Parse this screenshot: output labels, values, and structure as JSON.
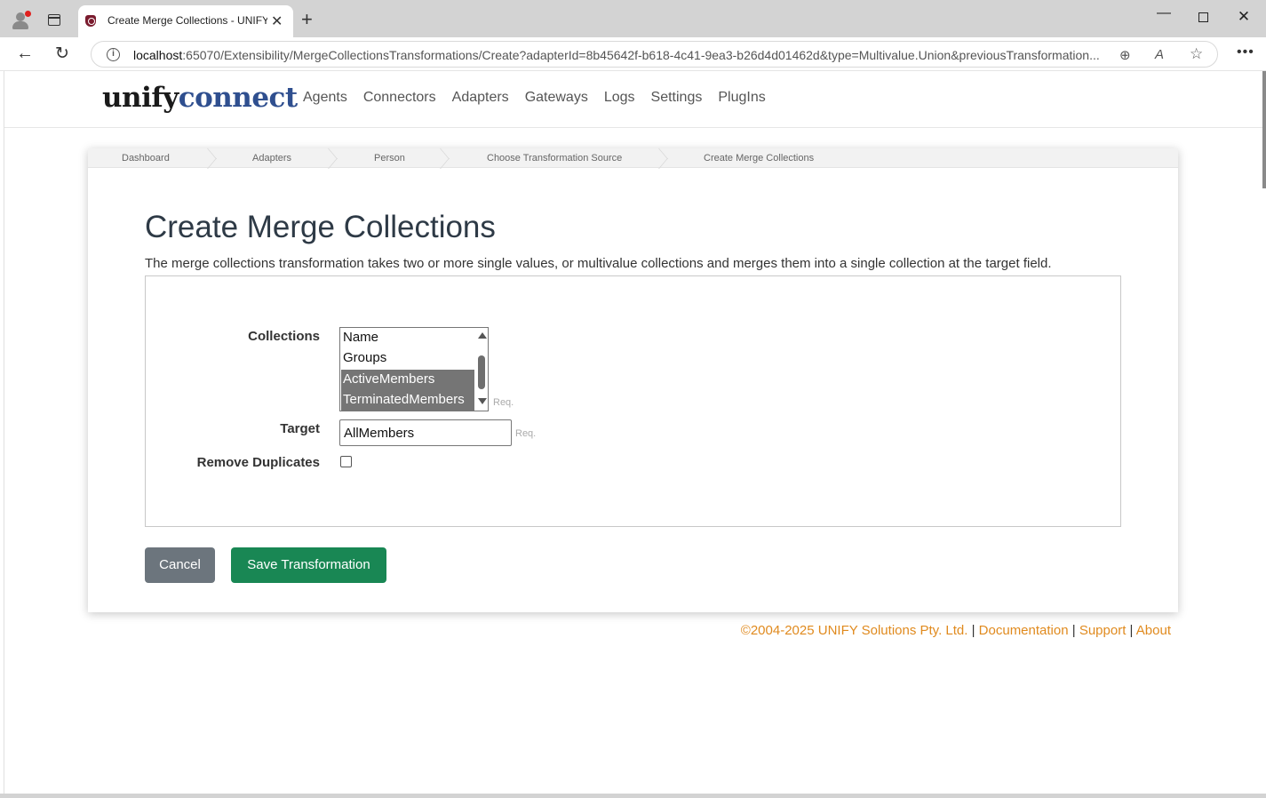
{
  "browser": {
    "tab_title": "Create Merge Collections - UNIFY",
    "url_host": "localhost",
    "url_rest": ":65070/Extensibility/MergeCollectionsTransformations/Create?adapterId=8b45642f-b618-4c41-9ea3-b26d4d01462d&type=Multivalue.Union&previousTransformation..."
  },
  "logo": {
    "part1": "unify",
    "part2": "connect"
  },
  "nav": [
    "Agents",
    "Connectors",
    "Adapters",
    "Gateways",
    "Logs",
    "Settings",
    "PlugIns"
  ],
  "breadcrumb": [
    "Dashboard",
    "Adapters",
    "Person",
    "Choose Transformation Source",
    "Create Merge Collections"
  ],
  "page": {
    "title": "Create Merge Collections",
    "description": "The merge collections transformation takes two or more single values, or multivalue collections and merges them into a single collection at the target field."
  },
  "form": {
    "collections_label": "Collections",
    "collections_options": [
      {
        "label": "Name",
        "selected": false
      },
      {
        "label": "Groups",
        "selected": false
      },
      {
        "label": "ActiveMembers",
        "selected": true
      },
      {
        "label": "TerminatedMembers",
        "selected": true
      }
    ],
    "required_hint": "Req.",
    "target_label": "Target",
    "target_value": "AllMembers",
    "remove_duplicates_label": "Remove Duplicates",
    "remove_duplicates_checked": false
  },
  "buttons": {
    "cancel": "Cancel",
    "save": "Save Transformation"
  },
  "footer": {
    "copyright": "©2004-2025 UNIFY Solutions Pty. Ltd.",
    "documentation": "Documentation",
    "support": "Support",
    "about": "About",
    "separator": "|"
  },
  "colors": {
    "link_orange": "#e08a1e",
    "save_green": "#198754",
    "cancel_gray": "#6c757d",
    "logo_blue": "#2f4f8f"
  }
}
